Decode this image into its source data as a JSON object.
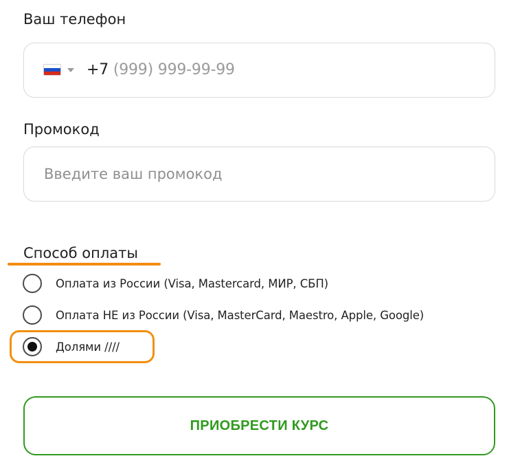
{
  "phone": {
    "label": "Ваш телефон",
    "country_flag": "russia-flag",
    "prefix": "+7",
    "placeholder": "(999) 999-99-99"
  },
  "promo": {
    "label": "Промокод",
    "placeholder": "Введите ваш промокод"
  },
  "payment": {
    "title": "Способ оплаты",
    "options": [
      {
        "label": "Оплата из России (Visa, Mastercard, МИР, СБП)",
        "selected": false
      },
      {
        "label": "Оплата НЕ из России (Visa, MasterCard, Maestro, Apple, Google)",
        "selected": false
      },
      {
        "label": "Долями ////",
        "selected": true
      }
    ]
  },
  "buy_button": {
    "label": "ПРИОБРЕСТИ КУРС"
  },
  "colors": {
    "accent_green": "#2f9a1d",
    "highlight_orange": "#f2900e",
    "border_gray": "#d9d9d9"
  }
}
